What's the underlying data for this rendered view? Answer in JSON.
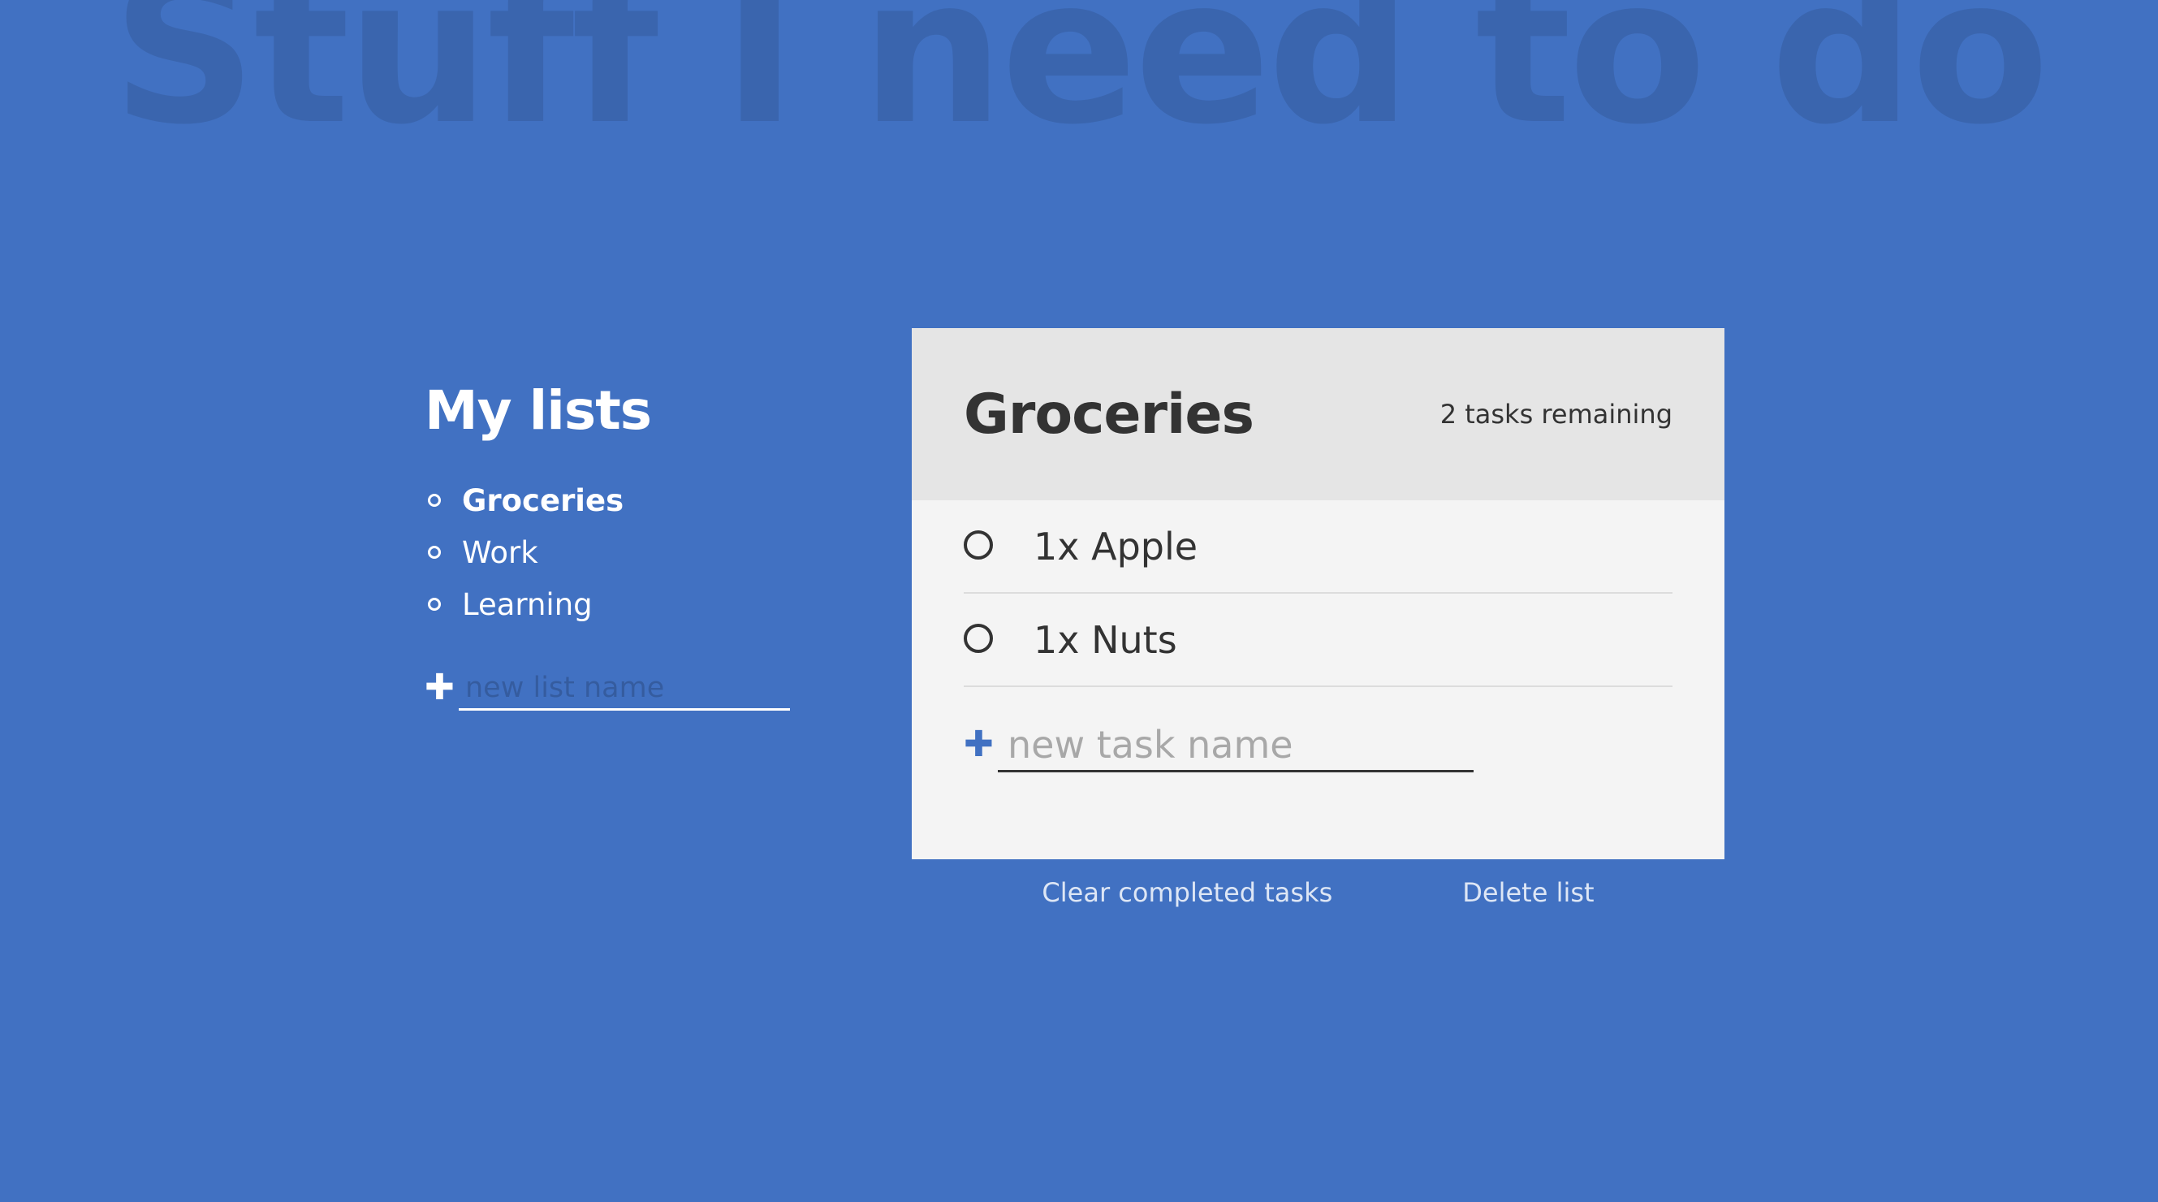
{
  "app": {
    "heading": "Stuff I need to do"
  },
  "sidebar": {
    "title": "My lists",
    "items": [
      {
        "label": "Groceries",
        "active": true
      },
      {
        "label": "Work",
        "active": false
      },
      {
        "label": "Learning",
        "active": false
      }
    ],
    "new_list_icon": "plus-icon",
    "new_list_placeholder": "new list name"
  },
  "panel": {
    "title": "Groceries",
    "task_count": "2 tasks remaining",
    "tasks": [
      {
        "label": "1x Apple",
        "completed": false
      },
      {
        "label": "1x Nuts",
        "completed": false
      }
    ],
    "new_task_icon": "plus-icon",
    "new_task_placeholder": "new task name"
  },
  "actions": {
    "clear_label": "Clear completed tasks",
    "delete_label": "Delete list"
  },
  "colors": {
    "background": "#4171c2",
    "panel": "#f4f4f4",
    "panel_header": "#e5e5e5",
    "text_dark": "#333333",
    "accent": "#4171c2"
  }
}
